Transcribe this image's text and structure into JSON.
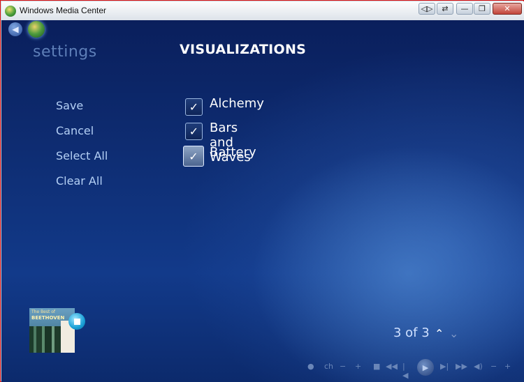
{
  "window": {
    "title": "Windows Media Center"
  },
  "titlebar": {
    "buttons": [
      "◁▷",
      "⇄",
      "—",
      "❐",
      "✕"
    ]
  },
  "nav": {
    "settings_label": "settings"
  },
  "page": {
    "title": "VISUALIZATIONS"
  },
  "menu": {
    "items": [
      "Save",
      "Cancel",
      "Select All",
      "Clear All"
    ]
  },
  "visualizations": [
    {
      "label": "Alchemy",
      "checked": true
    },
    {
      "label": "Bars and Waves",
      "checked": true
    },
    {
      "label": "Battery",
      "checked": true
    }
  ],
  "checkmark": "✓",
  "album": {
    "line1": "The Best of",
    "line2": "BEETHOVEN"
  },
  "pager": {
    "text": "3 of 3",
    "up": "⌃",
    "down": "⌄"
  },
  "transport": {
    "record": "●",
    "channel": "ch",
    "ch_down": "−",
    "ch_up": "+",
    "stop": "■",
    "rewind": "◀◀",
    "prev": "|◀",
    "play": "▶",
    "next": "▶|",
    "ffwd": "▶▶",
    "mute": "◀)",
    "vol_down": "−",
    "vol_up": "+"
  },
  "icons": {
    "back": "back-arrow-icon",
    "logo": "media-center-logo-icon",
    "stop": "stop-icon"
  },
  "colors": {
    "background": "#0f3078",
    "menu_text": "#b4d0f5",
    "accent": "#1aa0d6"
  }
}
